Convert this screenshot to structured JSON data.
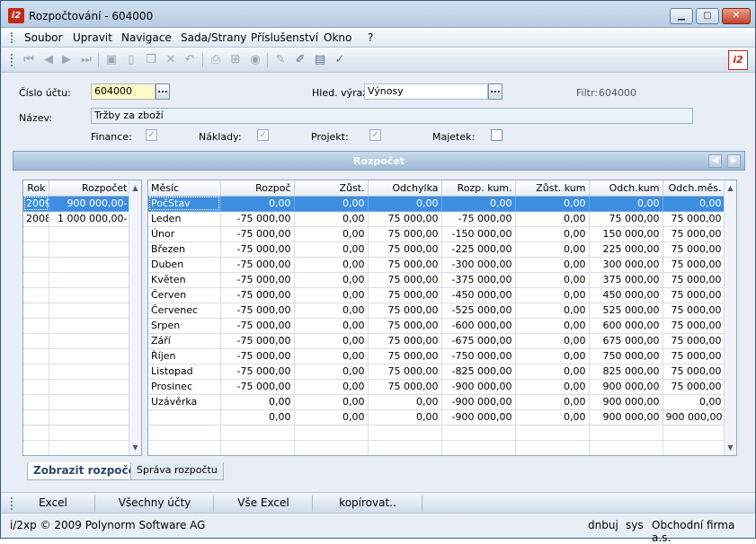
{
  "window": {
    "title": "Rozpočtování - 604000",
    "icon": "app-logo-icon"
  },
  "menu": [
    "Soubor",
    "Upravit",
    "Navigace",
    "Sada/Strany",
    "Příslušenství",
    "Okno",
    "?"
  ],
  "form": {
    "account_label": "Číslo účtu:",
    "account_value": "604000",
    "search_label": "Hled. výraz:",
    "search_value": "Výnosy",
    "filter_label": "Filtr:",
    "filter_value": "604000",
    "name_label": "Název:",
    "name_value": "Tržby za zboží",
    "finance_label": "Finance:",
    "costs_label": "Náklady:",
    "project_label": "Projekt:",
    "assets_label": "Majetek:",
    "ellipsis": "..."
  },
  "section": {
    "title": "Rozpočet"
  },
  "years": {
    "headers": [
      "Rok",
      "Rozpočet"
    ],
    "rows": [
      [
        "2009",
        "900 000,00-"
      ],
      [
        "2008",
        "1 000 000,00-"
      ]
    ]
  },
  "months": {
    "headers": [
      "Měsíc",
      "Rozpoč",
      "Zůst.",
      "Odchylka",
      "Rozp. kum.",
      "Zůst. kum",
      "Odch.kum",
      "Odch.měs."
    ],
    "rows": [
      [
        "PočStav",
        "0,00",
        "0,00",
        "0,00",
        "0,00",
        "0,00",
        "0,00",
        "0,00"
      ],
      [
        "Leden",
        "-75 000,00",
        "0,00",
        "75 000,00",
        "-75 000,00",
        "0,00",
        "75 000,00",
        "75 000,00"
      ],
      [
        "Únor",
        "-75 000,00",
        "0,00",
        "75 000,00",
        "-150 000,00",
        "0,00",
        "150 000,00",
        "75 000,00"
      ],
      [
        "Březen",
        "-75 000,00",
        "0,00",
        "75 000,00",
        "-225 000,00",
        "0,00",
        "225 000,00",
        "75 000,00"
      ],
      [
        "Duben",
        "-75 000,00",
        "0,00",
        "75 000,00",
        "-300 000,00",
        "0,00",
        "300 000,00",
        "75 000,00"
      ],
      [
        "Květen",
        "-75 000,00",
        "0,00",
        "75 000,00",
        "-375 000,00",
        "0,00",
        "375 000,00",
        "75 000,00"
      ],
      [
        "Červen",
        "-75 000,00",
        "0,00",
        "75 000,00",
        "-450 000,00",
        "0,00",
        "450 000,00",
        "75 000,00"
      ],
      [
        "Červenec",
        "-75 000,00",
        "0,00",
        "75 000,00",
        "-525 000,00",
        "0,00",
        "525 000,00",
        "75 000,00"
      ],
      [
        "Srpen",
        "-75 000,00",
        "0,00",
        "75 000,00",
        "-600 000,00",
        "0,00",
        "600 000,00",
        "75 000,00"
      ],
      [
        "Září",
        "-75 000,00",
        "0,00",
        "75 000,00",
        "-675 000,00",
        "0,00",
        "675 000,00",
        "75 000,00"
      ],
      [
        "Říjen",
        "-75 000,00",
        "0,00",
        "75 000,00",
        "-750 000,00",
        "0,00",
        "750 000,00",
        "75 000,00"
      ],
      [
        "Listopad",
        "-75 000,00",
        "0,00",
        "75 000,00",
        "-825 000,00",
        "0,00",
        "825 000,00",
        "75 000,00"
      ],
      [
        "Prosinec",
        "-75 000,00",
        "0,00",
        "75 000,00",
        "-900 000,00",
        "0,00",
        "900 000,00",
        "75 000,00"
      ],
      [
        "Uzávěrka",
        "0,00",
        "0,00",
        "0,00",
        "-900 000,00",
        "0,00",
        "900 000,00",
        "0,00"
      ],
      [
        "",
        "0,00",
        "0,00",
        "0,00",
        "-900 000,00",
        "0,00",
        "900 000,00",
        "900 000,00"
      ]
    ]
  },
  "tabs": [
    "Zobrazit rozpočet",
    "Správa rozpočtu"
  ],
  "buttons": [
    "Excel",
    "Všechny účty",
    "Vše Excel",
    "kopírovat.."
  ],
  "status": {
    "copyright": "i/2xp © 2009 Polynorm Software AG",
    "user": "dnbuj",
    "system": "sys",
    "company": "Obchodní firma a.s."
  },
  "colors": {
    "selection": "#3d8ee0",
    "title_bar": "#b7cde3",
    "account_field": "#fff9c4",
    "logo": "#c62818"
  }
}
